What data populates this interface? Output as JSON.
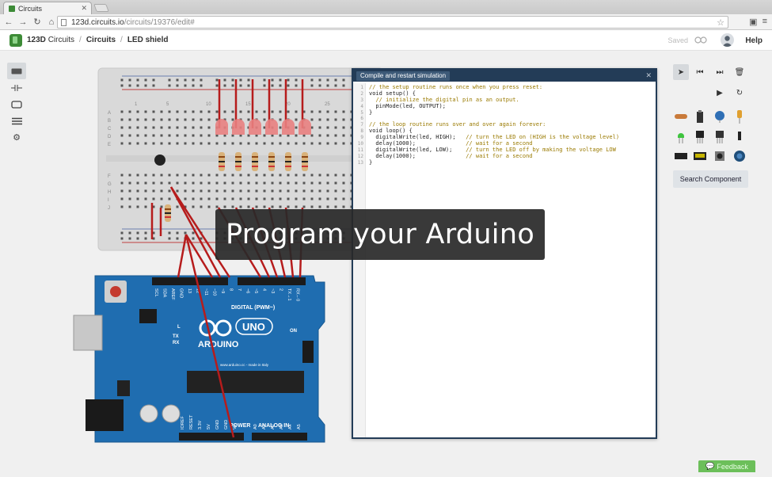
{
  "browser": {
    "tab_title": "Circuits",
    "url_host": "123d.circuits.io",
    "url_path": "/circuits/19376/edit#"
  },
  "header": {
    "brand": "123D",
    "brand_suffix": "Circuits",
    "crumb_circuits": "Circuits",
    "crumb_current": "LED shield",
    "separator": "/",
    "saved_label": "Saved",
    "help_label": "Help"
  },
  "editor": {
    "compile_label": "Compile and restart simulation",
    "line_numbers": [
      "1",
      "2",
      "3",
      "4",
      "5",
      "6",
      "7",
      "8",
      "9",
      "10",
      "11",
      "12",
      "13"
    ],
    "lines": [
      "// the setup routine runs once when you press reset:",
      "void setup() {",
      "  // initialize the digital pin as an output.",
      "  pinMode(led, OUTPUT);",
      "}",
      "",
      "// the loop routine runs over and over again forever:",
      "void loop() {",
      "  digitalWrite(led, HIGH);   // turn the LED on (HIGH is the voltage level)",
      "  delay(1000);               // wait for a second",
      "  digitalWrite(led, LOW);    // turn the LED off by making the voltage LOW",
      "  delay(1000);               // wait for a second",
      "}"
    ]
  },
  "right_panel": {
    "search_label": "Search Component"
  },
  "board": {
    "uno_label": "UNO",
    "arduino_label": "ARDUINO",
    "digital_label": "DIGITAL (PWM~)",
    "power_label": "POWER",
    "analog_label": "ANALOG IN",
    "on_label": "ON",
    "l_label": "L",
    "tx_label": "TX",
    "rx_label": "RX",
    "site_label": "www.arduino.cc - made in Italy",
    "top_pins": [
      "SCL",
      "SDA",
      "AREF",
      "GND",
      "13",
      "12",
      "~11",
      "~10",
      "~9",
      "8",
      "7",
      "~6",
      "~5",
      "4",
      "~3",
      "2",
      "TX→1",
      "RX←0"
    ],
    "power_pins": [
      "IOREF",
      "RESET",
      "3.3V",
      "5V",
      "GND",
      "GND",
      "Vin"
    ],
    "analog_pins": [
      "A0",
      "A1",
      "A2",
      "A3",
      "A4",
      "A5"
    ]
  },
  "breadboard": {
    "rows": [
      "A",
      "B",
      "C",
      "D",
      "E",
      "F",
      "G",
      "H",
      "I",
      "J"
    ],
    "cols": [
      "1",
      "5",
      "10",
      "15",
      "20",
      "25"
    ]
  },
  "caption": "Program your Arduino",
  "feedback_label": "Feedback",
  "colors": {
    "wire": "#b61c1c",
    "board": "#1f6db0",
    "editor_frame": "#233c57",
    "feedback": "#6cbf5a"
  }
}
